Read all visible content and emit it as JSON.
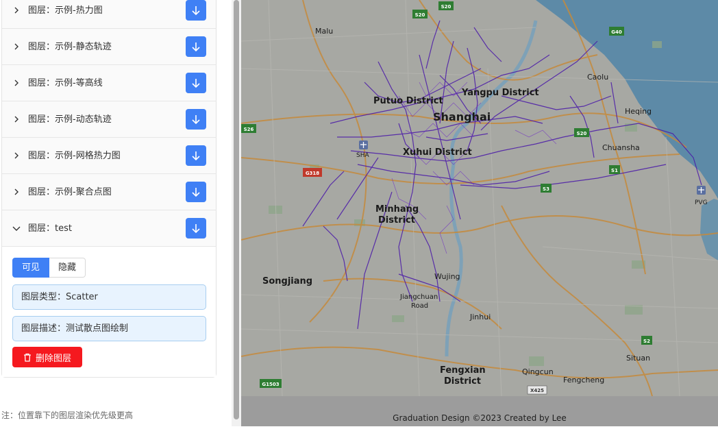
{
  "sidebar": {
    "layers": [
      {
        "label": "图层：示例-热力图",
        "expanded": false
      },
      {
        "label": "图层：示例-静态轨迹",
        "expanded": false
      },
      {
        "label": "图层：示例-等高线",
        "expanded": false
      },
      {
        "label": "图层：示例-动态轨迹",
        "expanded": false
      },
      {
        "label": "图层：示例-网格热力图",
        "expanded": false
      },
      {
        "label": "图层：示例-聚合点图",
        "expanded": false
      },
      {
        "label": "图层：test",
        "expanded": true
      }
    ],
    "detail": {
      "visible_label": "可见",
      "hidden_label": "隐藏",
      "type_text": "图层类型：Scatter",
      "desc_text": "图层描述：测试散点图绘制",
      "delete_label": "删除图层"
    },
    "note": "注：位置靠下的图层渲染优先级更高"
  },
  "map": {
    "places": {
      "malu": "Malu",
      "putuo": "Putuo District",
      "yangpu": "Yangpu District",
      "shanghai": "Shanghai",
      "xuhui": "Xuhui District",
      "caolu": "Caolu",
      "heqing": "Heqing",
      "chuansha": "Chuansha",
      "minhang": "Minhang",
      "minhang2": "District",
      "songjiang": "Songjiang",
      "wujing": "Wujing",
      "jiangchuan": "Jiangchuan",
      "jiangchuan2": "Road",
      "jinhui": "Jinhui",
      "situan": "Situan",
      "fengxian": "Fengxian",
      "fengxian2": "District",
      "qingcun": "Qingcun",
      "fengcheng": "Fengcheng",
      "sha": "SHA",
      "pvg": "PVG"
    },
    "shields": {
      "s20a": "S20",
      "s20b": "S20",
      "g40": "G40",
      "s26": "S26",
      "s20c": "S20",
      "s1": "S1",
      "s3": "S3",
      "g318": "G318",
      "s2": "S2",
      "g1503": "G1503",
      "x425": "X425"
    }
  },
  "footer": {
    "text": "Graduation Design ©2023 Created by Lee"
  },
  "colors": {
    "primary": "#3f80f5",
    "danger": "#f5191f",
    "info_bg": "#e8f3fe",
    "map_land": "#a7a8a3",
    "map_water": "#5d8aa7",
    "track": "#4a18a8"
  }
}
